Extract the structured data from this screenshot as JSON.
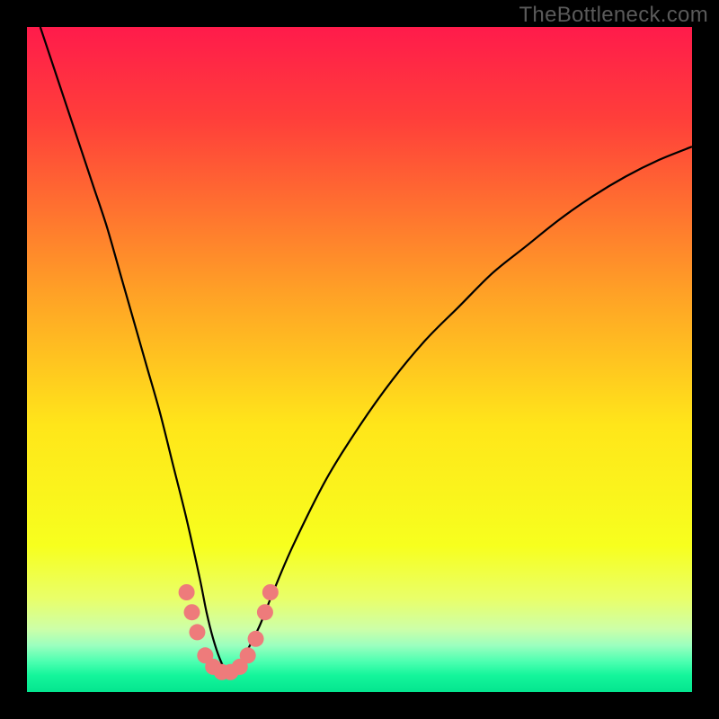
{
  "watermark": "TheBottleneck.com",
  "chart_data": {
    "type": "line",
    "title": "",
    "xlabel": "",
    "ylabel": "",
    "xlim": [
      0,
      100
    ],
    "ylim": [
      0,
      100
    ],
    "gradient_stops": [
      {
        "offset": 0,
        "color": "#ff1b4b"
      },
      {
        "offset": 0.14,
        "color": "#ff3f3a"
      },
      {
        "offset": 0.4,
        "color": "#ffa126"
      },
      {
        "offset": 0.6,
        "color": "#ffe61a"
      },
      {
        "offset": 0.78,
        "color": "#f7ff1e"
      },
      {
        "offset": 0.86,
        "color": "#e9ff6a"
      },
      {
        "offset": 0.905,
        "color": "#cdffa8"
      },
      {
        "offset": 0.93,
        "color": "#9bffbf"
      },
      {
        "offset": 0.955,
        "color": "#4affb0"
      },
      {
        "offset": 0.975,
        "color": "#14f59b"
      },
      {
        "offset": 1.0,
        "color": "#04e58f"
      }
    ],
    "series": [
      {
        "name": "bottleneck-curve",
        "x": [
          2,
          4,
          6,
          8,
          10,
          12,
          14,
          16,
          18,
          20,
          22,
          24,
          26,
          27,
          28,
          29,
          30,
          31,
          32,
          33,
          35,
          37,
          40,
          45,
          50,
          55,
          60,
          65,
          70,
          75,
          80,
          85,
          90,
          95,
          100
        ],
        "y": [
          100,
          94,
          88,
          82,
          76,
          70,
          63,
          56,
          49,
          42,
          34,
          26,
          17,
          12,
          8,
          5,
          3,
          3,
          4,
          6,
          10,
          15,
          22,
          32,
          40,
          47,
          53,
          58,
          63,
          67,
          71,
          74.5,
          77.5,
          80,
          82
        ]
      }
    ],
    "markers": {
      "name": "highlight-dots",
      "color": "#ee7b7b",
      "points": [
        {
          "x": 24.0,
          "y": 15.0
        },
        {
          "x": 24.8,
          "y": 12.0
        },
        {
          "x": 25.6,
          "y": 9.0
        },
        {
          "x": 26.8,
          "y": 5.5
        },
        {
          "x": 28.0,
          "y": 3.8
        },
        {
          "x": 29.3,
          "y": 3.0
        },
        {
          "x": 30.6,
          "y": 3.0
        },
        {
          "x": 32.0,
          "y": 3.8
        },
        {
          "x": 33.2,
          "y": 5.5
        },
        {
          "x": 34.4,
          "y": 8.0
        },
        {
          "x": 35.8,
          "y": 12.0
        },
        {
          "x": 36.6,
          "y": 15.0
        }
      ]
    }
  }
}
